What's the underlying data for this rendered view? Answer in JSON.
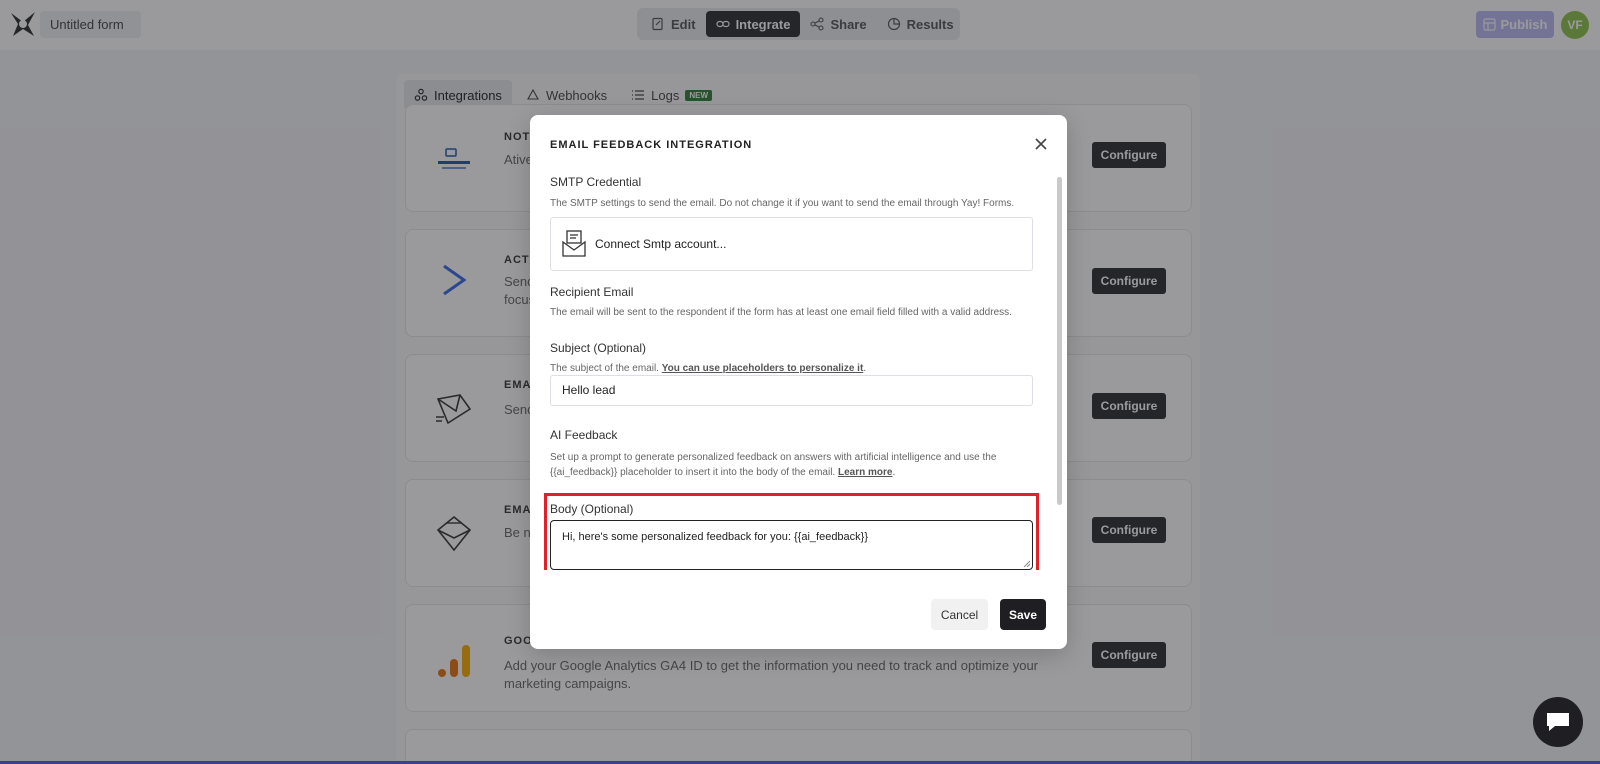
{
  "header": {
    "form_name": "Untitled form",
    "nav": [
      {
        "label": "Edit",
        "icon": "edit-icon",
        "active": false
      },
      {
        "label": "Integrate",
        "icon": "link-icon",
        "active": true
      },
      {
        "label": "Share",
        "icon": "share-icon",
        "active": false
      },
      {
        "label": "Results",
        "icon": "results-icon",
        "active": false
      }
    ],
    "publish_label": "Publish",
    "avatar_initials": "VF"
  },
  "subtabs": [
    {
      "label": "Integrations",
      "icon": "integrations-icon"
    },
    {
      "label": "Webhooks",
      "icon": "webhook-icon"
    },
    {
      "label": "Logs",
      "icon": "list-icon",
      "badge": "NEW"
    }
  ],
  "cards": [
    {
      "title": "NOTI",
      "desc": "Ative",
      "icon": "notification-logo-icon",
      "configure": "Configure"
    },
    {
      "title": "ACTI",
      "desc": "Send\nfocus",
      "icon": "activecampaign-icon",
      "configure": "Configure"
    },
    {
      "title": "EMA",
      "desc": "Send",
      "icon": "email-icon",
      "configure": "Configure"
    },
    {
      "title": "EMA",
      "desc": "Be no",
      "icon": "email-open-icon",
      "configure": "Configure"
    },
    {
      "title": "GOO",
      "desc": "Add your Google Analytics GA4 ID to get the information you need to track and optimize your marketing campaigns.",
      "icon": "google-analytics-icon",
      "configure": "Configure"
    }
  ],
  "modal": {
    "title": "EMAIL FEEDBACK INTEGRATION",
    "smtp": {
      "label": "SMTP Credential",
      "help": "The SMTP settings to send the email. Do not change it if you want to send the email through Yay! Forms.",
      "connect_label": "Connect Smtp account..."
    },
    "recipient": {
      "label": "Recipient Email",
      "help": "The email will be sent to the respondent if the form has at least one email field filled with a valid address."
    },
    "subject": {
      "label": "Subject (Optional)",
      "help_prefix": "The subject of the email. ",
      "help_link": "You can use placeholders to personalize it",
      "help_suffix": ".",
      "value": "Hello lead"
    },
    "ai_feedback": {
      "label": "AI Feedback",
      "help_prefix": "Set up a prompt to generate personalized feedback on answers with artificial intelligence and use the {{ai_feedback}} placeholder to insert it into the body of the email. ",
      "help_link": "Learn more",
      "help_suffix": "."
    },
    "body": {
      "label": "Body (Optional)",
      "value": "Hi, here's some personalized feedback for you: {{ai_feedback}}"
    },
    "cancel_label": "Cancel",
    "save_label": "Save"
  },
  "colors": {
    "accent_dark": "#1f1f23",
    "highlight": "#e0202a",
    "avatar": "#8bc34a",
    "publish": "#b7b9f2",
    "badge_new": "#2e7d32"
  }
}
